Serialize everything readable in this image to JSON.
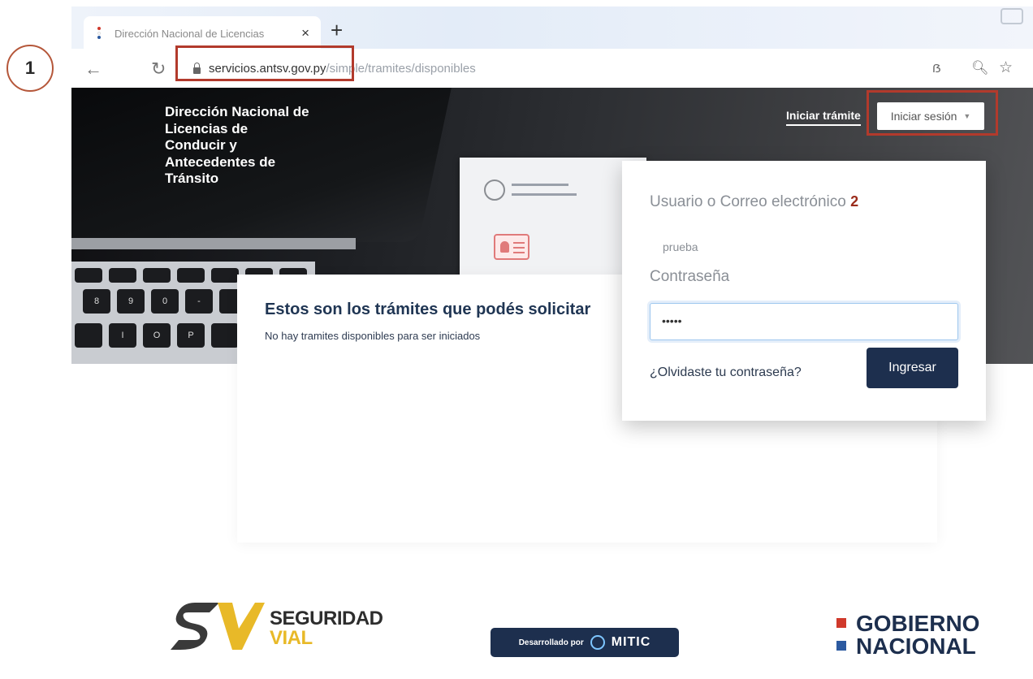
{
  "annotations": {
    "step1": "1",
    "step2": "2"
  },
  "browser": {
    "tab_title": "Dirección Nacional de Licencias",
    "tab_close": "×",
    "new_tab": "+",
    "url_host": "servicios.antsv.gov.py",
    "url_path": "/simple/tramites/disponibles"
  },
  "header": {
    "site_title": "Dirección Nacional de Licencias de Conducir y Antecedentes de Tránsito",
    "nav_link": "Iniciar trámite",
    "login_button": "Iniciar sesión"
  },
  "main": {
    "title": "Estos son los trámites que podés solicitar",
    "subtitle": "No hay tramites disponibles para ser iniciados"
  },
  "login": {
    "user_label": "Usuario o Correo electrónico",
    "user_value": "prueba",
    "password_label": "Contraseña",
    "password_value": "•••••",
    "forgot_link": "¿Olvidaste tu contraseña?",
    "submit": "Ingresar"
  },
  "footer": {
    "seguridad_line1": "SEGURIDAD",
    "seguridad_line2": "VIAL",
    "mitic_prefix": "Desarrollado por",
    "mitic_name": "MITIC",
    "gobierno_line1": "GOBIERNO",
    "gobierno_line2": "NACIONAL"
  },
  "colors": {
    "accent_navy": "#1d2f4e",
    "annotation_red": "#b23a2c",
    "seguridad_yellow": "#e8b928",
    "gobierno_red": "#d0392b",
    "gobierno_blue": "#2c5aa0"
  }
}
